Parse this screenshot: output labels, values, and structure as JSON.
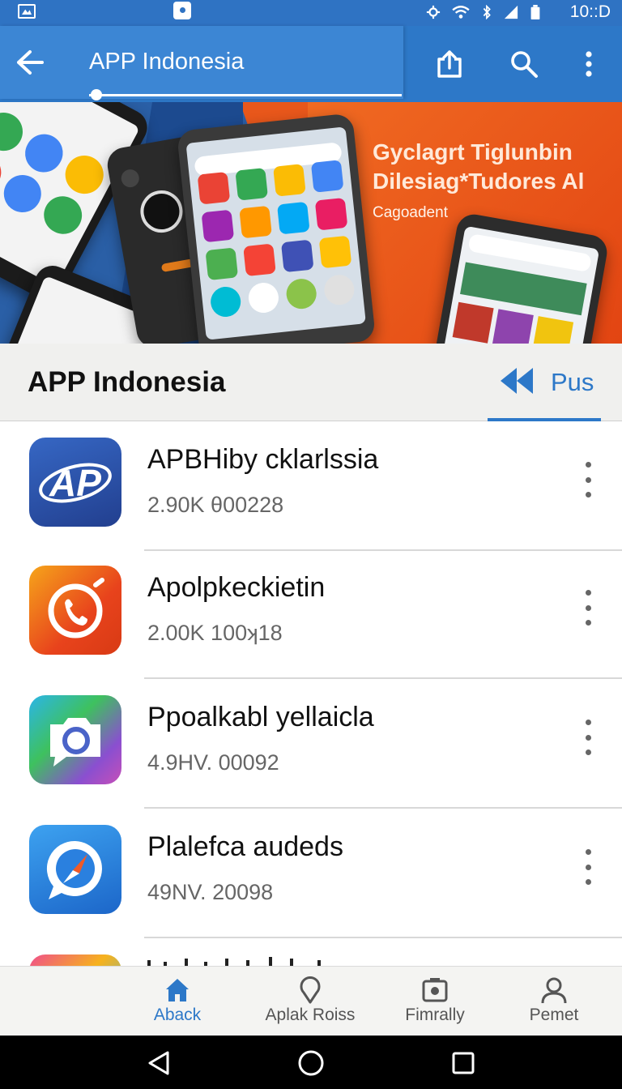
{
  "status_bar": {
    "time": "10::D",
    "icons": [
      "gallery-icon",
      "notification-icon",
      "settings-icon",
      "wifi-icon",
      "bluetooth-icon",
      "signal-icon",
      "battery-icon"
    ]
  },
  "app_bar": {
    "title": "APP Indonesia",
    "actions": [
      "share-icon",
      "search-icon",
      "more-vert-icon"
    ]
  },
  "banner": {
    "headline_1": "Gyclagrt Tiglunbin",
    "headline_2": "Dilesiag*Tudores Al",
    "subtitle": "Cagoadent"
  },
  "section": {
    "title": "APP Indonesia",
    "tab_label": "Pus"
  },
  "apps": [
    {
      "name": "APBHiby cklarlssia",
      "meta": "2.90K θ00228",
      "icon_text": "AP"
    },
    {
      "name": "Apolpkeckietin",
      "meta": "2.00K 100ʞ18"
    },
    {
      "name": "Ppoalkabl yellaicla",
      "meta": "4.9HV. 00092"
    },
    {
      "name": "Plalefca audeds",
      "meta": "49NV. 20098"
    }
  ],
  "bottom_nav": [
    {
      "label": "Aback",
      "icon": "home-icon",
      "active": true
    },
    {
      "label": "Aplak Roiss",
      "icon": "location-icon",
      "active": false
    },
    {
      "label": "Fimrally",
      "icon": "photo-icon",
      "active": false
    },
    {
      "label": "Pemet",
      "icon": "person-icon",
      "active": false
    }
  ],
  "colors": {
    "primary": "#2d78c8",
    "status_bar": "#2f73c3",
    "banner_orange": "#e8571b",
    "banner_blue": "#2a5fa6"
  }
}
